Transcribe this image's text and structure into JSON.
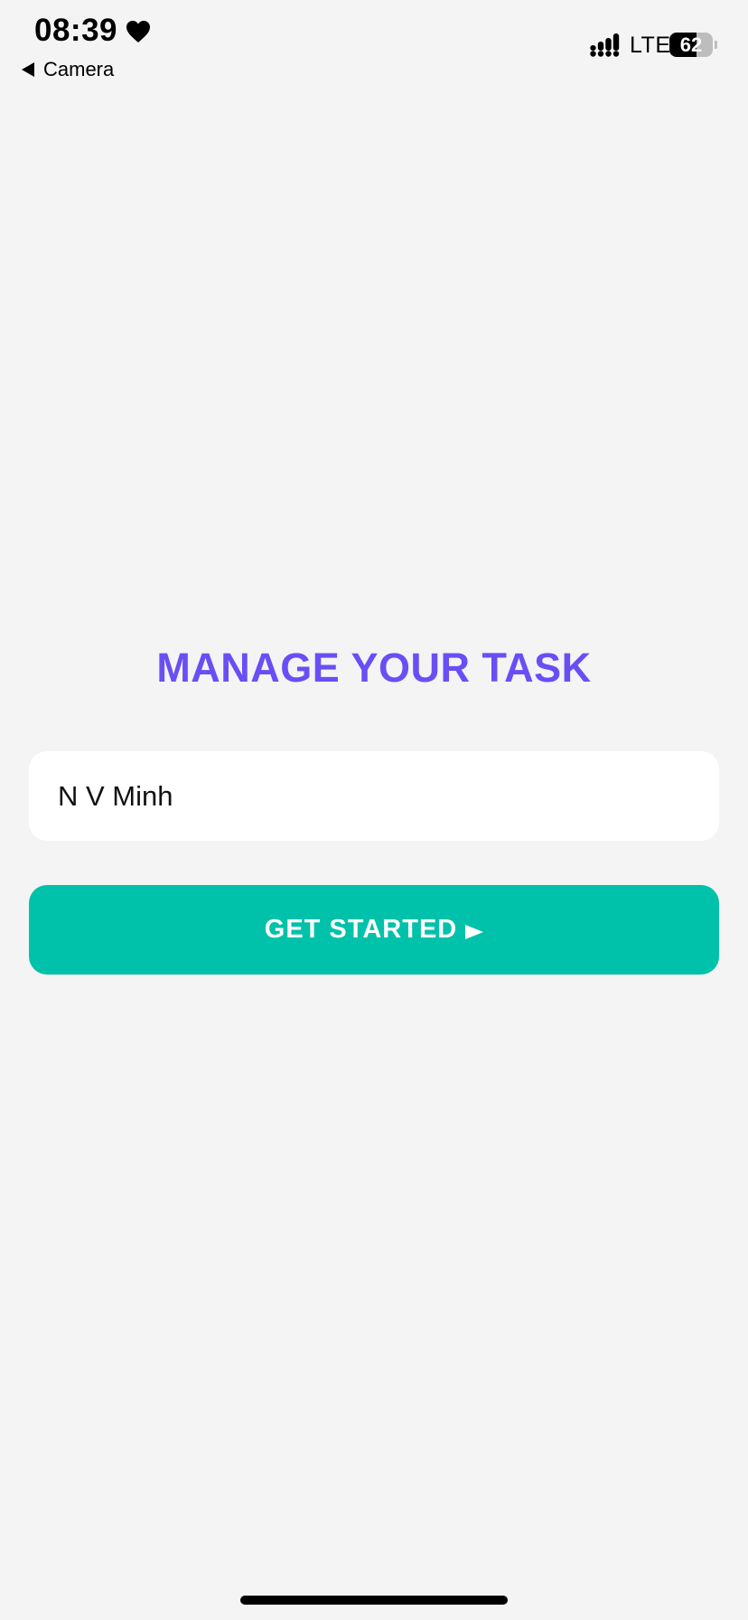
{
  "status_bar": {
    "time": "08:39",
    "time_icon": "heart-icon",
    "back_label": "Camera",
    "back_icon": "back-arrow-icon",
    "signal_icon": "signal-bars-icon",
    "network": "LTE",
    "battery_level": "62",
    "battery_fraction": 0.62
  },
  "main": {
    "title": "MANAGE YOUR TASK",
    "title_color": "#6a4ef5",
    "name_input_value": "N V Minh",
    "button_label": "GET STARTED",
    "button_icon": "play-arrow-icon",
    "button_color": "#00c1aa"
  },
  "colors": {
    "background": "#f4f4f4",
    "input_background": "#ffffff"
  }
}
